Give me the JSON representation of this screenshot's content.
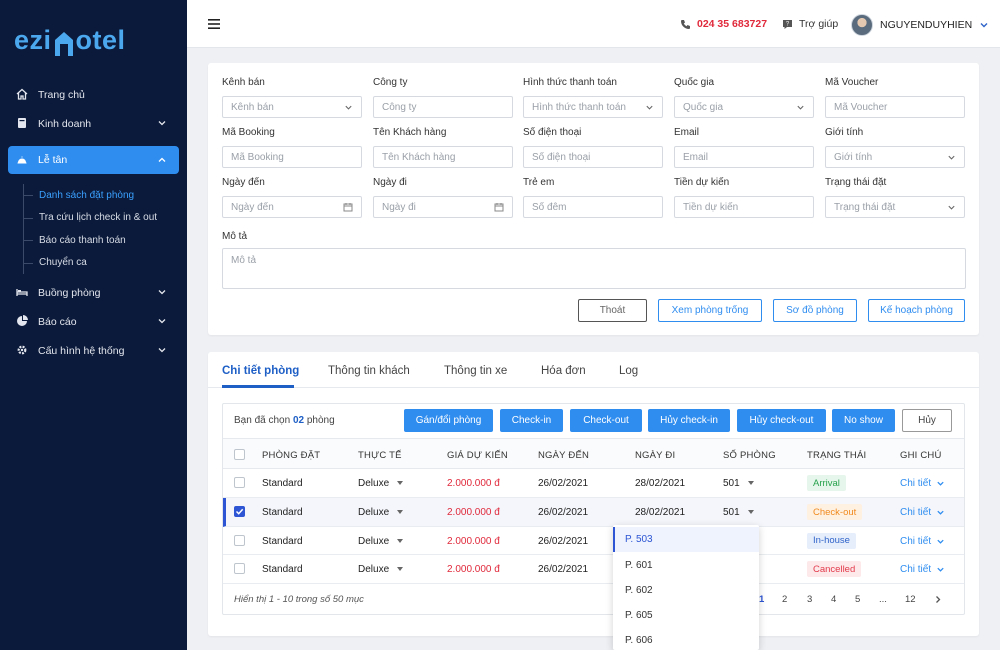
{
  "sidebar": {
    "logo_left": "ezi",
    "logo_right": "otel",
    "items": [
      {
        "label": "Trang chủ",
        "icon": "home-icon"
      },
      {
        "label": "Kinh doanh",
        "icon": "book-icon"
      },
      {
        "label": "Lễ tân",
        "icon": "reception-bell-icon"
      },
      {
        "label": "Buồng phòng",
        "icon": "bed-icon"
      },
      {
        "label": "Báo cáo",
        "icon": "pie-chart-icon"
      },
      {
        "label": "Cấu hình hệ thống",
        "icon": "gear-icon"
      }
    ],
    "subitems": [
      "Danh sách đặt phòng",
      "Tra cứu lịch check in & out",
      "Báo cáo thanh toán",
      "Chuyển ca"
    ]
  },
  "topbar": {
    "phone": "024 35 683727",
    "help": "Trợ giúp",
    "username": "NGUYENDUYHIEN"
  },
  "filters": [
    {
      "label": "Kênh bán",
      "placeholder": "Kênh bán",
      "type": "select"
    },
    {
      "label": "Công ty",
      "placeholder": "Công ty",
      "type": "text"
    },
    {
      "label": "Hình thức thanh toán",
      "placeholder": "Hình thức thanh toán",
      "type": "select"
    },
    {
      "label": "Quốc gia",
      "placeholder": "Quốc gia",
      "type": "select"
    },
    {
      "label": "Mã Voucher",
      "placeholder": "Mã Voucher",
      "type": "text"
    },
    {
      "label": "Mã Booking",
      "placeholder": "Mã Booking",
      "type": "text"
    },
    {
      "label": "Tên Khách hàng",
      "placeholder": "Tên Khách hàng",
      "type": "text"
    },
    {
      "label": "Số điện thoại",
      "placeholder": "Số điện thoại",
      "type": "text"
    },
    {
      "label": "Email",
      "placeholder": "Email",
      "type": "text"
    },
    {
      "label": "Giới tính",
      "placeholder": "Giới tính",
      "type": "select"
    },
    {
      "label": "Ngày đến",
      "placeholder": "Ngày đến",
      "type": "date"
    },
    {
      "label": "Ngày đi",
      "placeholder": "Ngày đi",
      "type": "date"
    },
    {
      "label": "Trẻ em",
      "placeholder": "Số đêm",
      "type": "text"
    },
    {
      "label": "Tiền dự kiến",
      "placeholder": "Tiền dự kiến",
      "type": "text"
    },
    {
      "label": "Trạng thái đặt",
      "placeholder": "Trạng thái đặt",
      "type": "select"
    }
  ],
  "description": {
    "label": "Mô tả",
    "placeholder": "Mô tả"
  },
  "filter_buttons": [
    "Thoát",
    "Xem phòng trống",
    "Sơ đồ phòng",
    "Kế hoạch phòng"
  ],
  "tabs": [
    "Chi tiết phòng",
    "Thông tin khách",
    "Thông tin xe",
    "Hóa đơn",
    "Log"
  ],
  "selection": {
    "prefix": "Bạn đã chọn",
    "count": "02",
    "suffix": "phòng"
  },
  "actions": [
    "Gán/đổi phòng",
    "Check-in",
    "Check-out",
    "Hủy check-in",
    "Hủy check-out",
    "No show",
    "Hủy"
  ],
  "columns": [
    "PHÒNG ĐẶT",
    "THỰC TẾ",
    "GIÁ DỰ KIẾN",
    "NGÀY ĐẾN",
    "NGÀY ĐI",
    "SỐ PHÒNG",
    "TRẠNG THÁI",
    "GHI CHÚ"
  ],
  "rows": [
    {
      "booked": "Standard",
      "actual": "Deluxe",
      "price": "2.000.000 đ",
      "arrive": "26/02/2021",
      "depart": "28/02/2021",
      "room": "501",
      "status": "Arrival",
      "note": "Chi tiết",
      "checked": false
    },
    {
      "booked": "Standard",
      "actual": "Deluxe",
      "price": "2.000.000 đ",
      "arrive": "26/02/2021",
      "depart": "28/02/2021",
      "room": "501",
      "status": "Check-out",
      "note": "Chi tiết",
      "checked": true
    },
    {
      "booked": "Standard",
      "actual": "Deluxe",
      "price": "2.000.000 đ",
      "arrive": "26/02/2021",
      "depart": "",
      "room": "",
      "status": "In-house",
      "note": "Chi tiết",
      "checked": false
    },
    {
      "booked": "Standard",
      "actual": "Deluxe",
      "price": "2.000.000 đ",
      "arrive": "26/02/2021",
      "depart": "",
      "room": "",
      "status": "Cancelled",
      "note": "Chi tiết",
      "checked": false
    }
  ],
  "footer": "Hiển thị 1 - 10 trong số 50 mục",
  "pagination": [
    "1",
    "2",
    "3",
    "4",
    "5",
    "...",
    "12"
  ],
  "room_dropdown": [
    "P. 503",
    "P. 601",
    "P. 602",
    "P. 605",
    "P. 606"
  ]
}
